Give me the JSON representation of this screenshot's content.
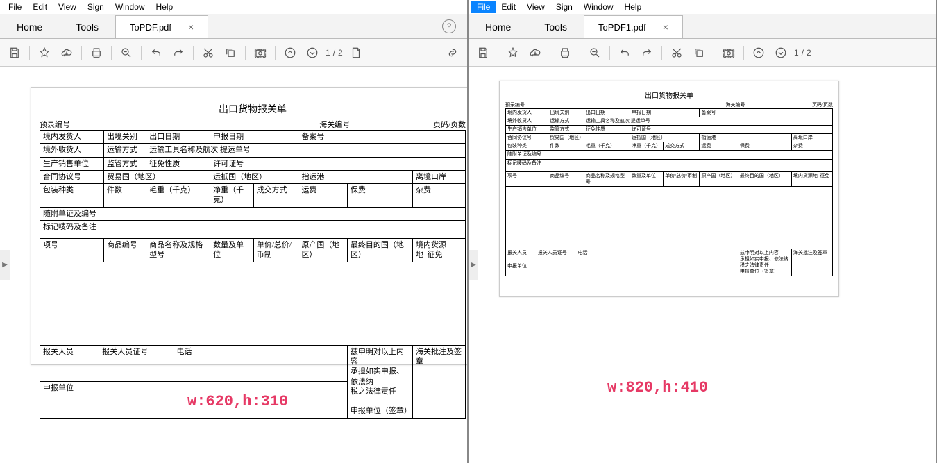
{
  "left": {
    "menu": [
      "File",
      "Edit",
      "View",
      "Sign",
      "Window",
      "Help"
    ],
    "menu_active": -1,
    "bigtabs": [
      "Home",
      "Tools"
    ],
    "doctab": "ToPDF.pdf",
    "page_cur": "1",
    "page_sep": "/",
    "page_total": "2",
    "overlay": "w:620,h:310"
  },
  "right": {
    "menu": [
      "File",
      "Edit",
      "View",
      "Sign",
      "Window",
      "Help"
    ],
    "menu_active": 0,
    "bigtabs": [
      "Home",
      "Tools"
    ],
    "doctab": "ToPDF1.pdf",
    "page_cur": "1",
    "page_sep": "/",
    "page_total": "2",
    "overlay": "w:820,h:410"
  },
  "form": {
    "title": "出口货物报关单",
    "pre_no": "预录编号",
    "customs_no": "海关编号",
    "page_lbl": "页码/页数",
    "r1": [
      "境内发货人",
      "出境关别",
      "出口日期",
      "申报日期",
      "备案号"
    ],
    "r2": [
      "境外收货人",
      "运输方式",
      "运输工具名称及航次 提运单号"
    ],
    "r3": [
      "生产销售单位",
      "监管方式",
      "征免性质",
      "许可证号"
    ],
    "r4": [
      "合同协议号",
      "贸易国（地区）",
      "运抵国（地区）",
      "指运港",
      "离境口岸"
    ],
    "r5": [
      "包装种类",
      "件数",
      "毛重（千克）",
      "净重（千克）",
      "成交方式",
      "运费",
      "保费",
      "杂费"
    ],
    "r6": "随附单证及编号",
    "r7": "标记唛码及备注",
    "r8": [
      "项号",
      "商品编号",
      "商品名称及规格型号",
      "数量及单位",
      "单价/总价/币制",
      "原产国（地区）",
      "最终目的国（地区）",
      "境内货源地",
      "征免"
    ],
    "f1": [
      "报关人员",
      "报关人员证号",
      "电话"
    ],
    "f_decl1": "兹申明对以上内容",
    "f_decl2": "承担如实申报、依法纳",
    "f_decl3": "税之法律责任",
    "f_unit": "申报单位",
    "f_stamp": "申报单位（签章）",
    "f_right": "海关批注及签章"
  }
}
